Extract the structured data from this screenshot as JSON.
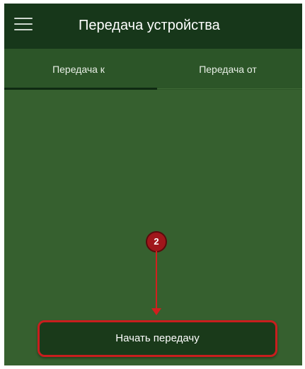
{
  "header": {
    "menu_icon": "hamburger-menu-icon",
    "title": "Передача устройства"
  },
  "tabs": [
    {
      "label": "Передача к",
      "selected": true
    },
    {
      "label": "Передача от",
      "selected": false
    }
  ],
  "annotation": {
    "step_number": "2",
    "color": "#d21f1f"
  },
  "actions": {
    "start_label": "Начать передачу"
  },
  "colors": {
    "appbar": "#17371a",
    "tabbar": "#2c5528",
    "content": "#36602f",
    "button": "#1a3a1a"
  }
}
